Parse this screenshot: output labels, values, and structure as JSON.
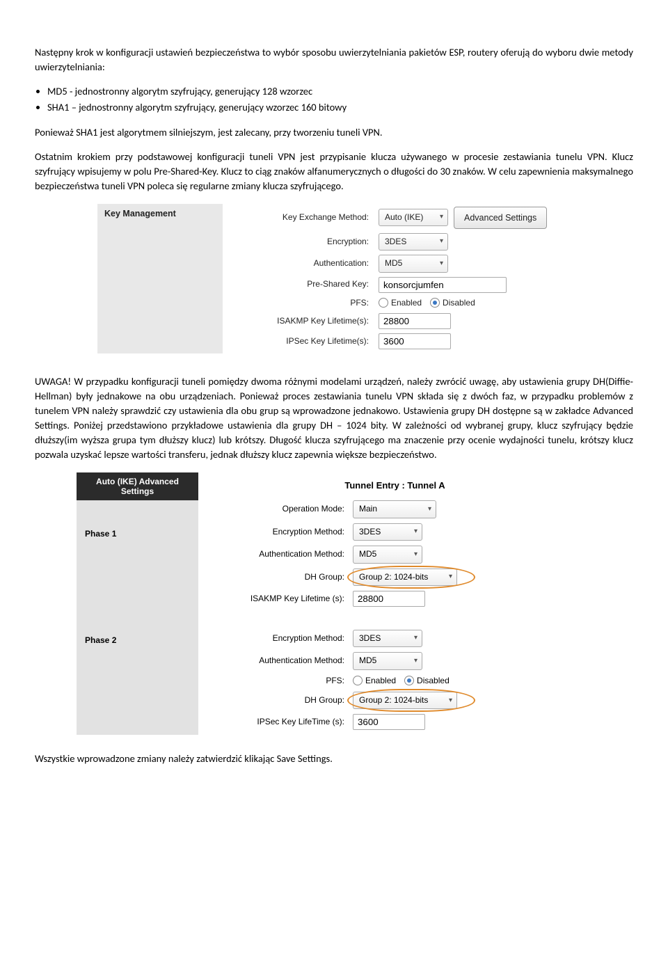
{
  "p1": "Następny krok w konfiguracji ustawień bezpieczeństwa to wybór sposobu uwierzytelniania pakietów ESP, routery oferują do wyboru dwie metody uwierzytelniania:",
  "b1": "MD5 - jednostronny algorytm szyfrujący, generujący 128 wzorzec",
  "b2": "SHA1 – jednostronny algorytm szyfrujący, generujący wzorzec 160 bitowy",
  "p2": "Ponieważ SHA1 jest algorytmem silniejszym, jest zalecany, przy tworzeniu tuneli VPN.",
  "p3": "Ostatnim krokiem przy podstawowej konfiguracji tuneli VPN jest przypisanie klucza używanego w procesie zestawiania tunelu VPN. Klucz szyfrujący wpisujemy w polu Pre-Shared-Key. Klucz to ciąg znaków alfanumerycznych o długości do 30 znaków. W celu zapewnienia maksymalnego bezpieczeństwa tuneli VPN poleca się regularne zmiany klucza szyfrującego.",
  "km": {
    "title": "Key Management",
    "r1": "Key Exchange Method:",
    "v1": "Auto (IKE)",
    "btn": "Advanced Settings",
    "r2": "Encryption:",
    "v2": "3DES",
    "r3": "Authentication:",
    "v3": "MD5",
    "r4": "Pre-Shared Key:",
    "v4": "konsorcjumfen",
    "r5": "PFS:",
    "en": "Enabled",
    "di": "Disabled",
    "r6": "ISAKMP Key Lifetime(s):",
    "v6": "28800",
    "r7": "IPSec Key Lifetime(s):",
    "v7": "3600"
  },
  "p4": "UWAGA! W przypadku konfiguracji tuneli pomiędzy dwoma różnymi modelami urządzeń, należy zwrócić uwagę, aby ustawienia grupy DH(Diffie-Hellman) były jednakowe na obu urządzeniach. Ponieważ proces zestawiania tunelu VPN składa się z dwóch faz, w przypadku problemów z tunelem VPN należy sprawdzić czy ustawienia dla obu grup są wprowadzone jednakowo. Ustawienia grupy DH dostępne są w zakładce Advanced Settings. Poniżej przedstawiono przykładowe ustawienia dla grupy DH – 1024 bity. W zależności od wybranej grupy, klucz szyfrujący będzie dłuższy(im wyższa grupa tym dłuższy klucz) lub krótszy. Długość klucza szyfrującego ma znaczenie przy ocenie wydajności tunelu, krótszy klucz pozwala uzyskać lepsze wartości transferu, jednak dłuższy klucz zapewnia większe bezpieczeństwo.",
  "adv": {
    "title": "Auto (IKE) Advanced Settings",
    "tun": "Tunnel Entry : Tunnel A",
    "ph1": "Phase 1",
    "ph2": "Phase 2",
    "op": "Operation Mode:",
    "opv": "Main",
    "em": "Encryption Method:",
    "emv": "3DES",
    "am": "Authentication Method:",
    "amv": "MD5",
    "dh": "DH Group:",
    "dhv": "Group 2: 1024-bits",
    "ik": "ISAKMP Key Lifetime (s):",
    "ikv": "28800",
    "pfs": "PFS:",
    "en": "Enabled",
    "di": "Disabled",
    "ip": "IPSec Key LifeTime (s):",
    "ipv": "3600"
  },
  "p5": "Wszystkie wprowadzone zmiany należy zatwierdzić klikając Save Settings."
}
